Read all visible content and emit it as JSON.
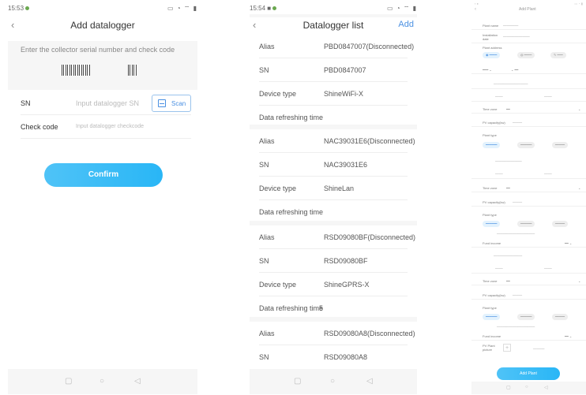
{
  "screen1": {
    "time": "15:53",
    "title": "Add datalogger",
    "hint": "Enter the collector serial number and check code",
    "sn_label": "SN",
    "sn_placeholder": "Input datalogger SN",
    "scan_label": "Scan",
    "check_label": "Check code",
    "check_placeholder": "Input datalogger checkcode",
    "confirm_label": "Confirm"
  },
  "screen2": {
    "time": "15:54",
    "title": "Datalogger list",
    "add_label": "Add",
    "labels": {
      "alias": "Alias",
      "sn": "SN",
      "device_type": "Device type",
      "refresh": "Data refreshing time"
    },
    "devices": [
      {
        "alias": "PBD0847007(Disconnected)",
        "sn": "PBD0847007",
        "type": "ShineWiFi-X",
        "refresh_suffix": ""
      },
      {
        "alias": "NAC39031E6(Disconnected)",
        "sn": "NAC39031E6",
        "type": "ShineLan",
        "refresh_suffix": ""
      },
      {
        "alias": "RSD09080BF(Disconnected)",
        "sn": "RSD09080BF",
        "type": "ShineGPRS-X",
        "refresh_suffix": "5"
      },
      {
        "alias": "RSD09080A8(Disconnected)",
        "sn": "RSD09080A8",
        "type": "",
        "refresh_suffix": ""
      }
    ]
  },
  "screen3": {
    "title": "Add Plant",
    "plant_name": "Plant name",
    "installation_date": "Installation date",
    "plant_address": "Plant address",
    "time_zone": "Time zone",
    "pv_capacity": "PV capacity(kw)",
    "plant_type": "Plant type",
    "fund_income": "Fund income",
    "pv_plant_picture": "PV Plant picture",
    "add_plant_label": "Add Plant"
  },
  "colors": {
    "accent": "#4a90e2",
    "button_gradient_start": "#4fc3f7",
    "button_gradient_end": "#29b6f6"
  }
}
